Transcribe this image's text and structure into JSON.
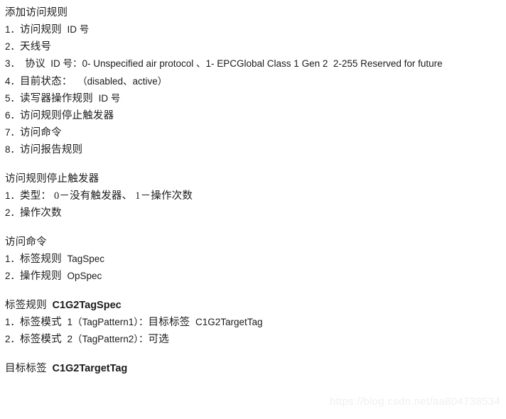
{
  "page": {
    "background_color": "#ffffff",
    "text_color": "#1b1b1b",
    "watermark_color": "#f0f0f0"
  },
  "watermark": {
    "text": "https://blog.csdn.net/aa804738534"
  },
  "sections": [
    {
      "id": "add-access-spec",
      "heading_cjk": "添加访问规则",
      "heading_latin": "",
      "items": [
        {
          "marker": "1．",
          "cjk": "访问规则",
          "latin": "ID 号",
          "tail": ""
        },
        {
          "marker": "2．",
          "cjk": "天线号",
          "latin": "",
          "tail": ""
        },
        {
          "marker": "3．",
          "cjk": "  协议",
          "latin": "ID 号：0- Unspecified air protocol",
          "tail": "、1- EPCGlobal Class 1 Gen 2  2-255 Reserved for future"
        },
        {
          "marker": "4．",
          "cjk": "目前状态：",
          "latin": "（disabled、active）",
          "tail": ""
        },
        {
          "marker": "5．",
          "cjk": "读写器操作规则",
          "latin": "ID 号",
          "tail": ""
        },
        {
          "marker": "6．",
          "cjk": "访问规则停止触发器",
          "latin": "",
          "tail": ""
        },
        {
          "marker": "7．",
          "cjk": "访问命令",
          "latin": "",
          "tail": ""
        },
        {
          "marker": "8．",
          "cjk": "访问报告规则",
          "latin": "",
          "tail": ""
        }
      ]
    },
    {
      "id": "access-spec-stop-trigger",
      "heading_cjk": "访问规则停止触发器",
      "heading_latin": "",
      "items": [
        {
          "marker": "1．",
          "cjk": "类型： 0－没有触发器、 1－操作次数",
          "latin": "",
          "tail": ""
        },
        {
          "marker": "2．",
          "cjk": "操作次数",
          "latin": "",
          "tail": ""
        }
      ]
    },
    {
      "id": "access-command",
      "heading_cjk": "访问命令",
      "heading_latin": "",
      "items": [
        {
          "marker": "1．",
          "cjk": "标签规则",
          "latin": "TagSpec",
          "tail": ""
        },
        {
          "marker": "2．",
          "cjk": "操作规则",
          "latin": "OpSpec",
          "tail": ""
        }
      ]
    },
    {
      "id": "tag-spec",
      "heading_cjk": "标签规则",
      "heading_latin": "C1G2TagSpec",
      "items": [
        {
          "marker": "1．",
          "cjk": "标签模式",
          "latin": "1（TagPattern1）：",
          "tail": "",
          "cjk2": "目标标签",
          "latin2": "C1G2TargetTag"
        },
        {
          "marker": "2．",
          "cjk": "标签模式",
          "latin": "2（TagPattern2）：",
          "tail": "",
          "cjk2": "可选",
          "latin2": ""
        }
      ]
    },
    {
      "id": "target-tag",
      "heading_cjk": "目标标签",
      "heading_latin": "C1G2TargetTag",
      "items": []
    }
  ]
}
